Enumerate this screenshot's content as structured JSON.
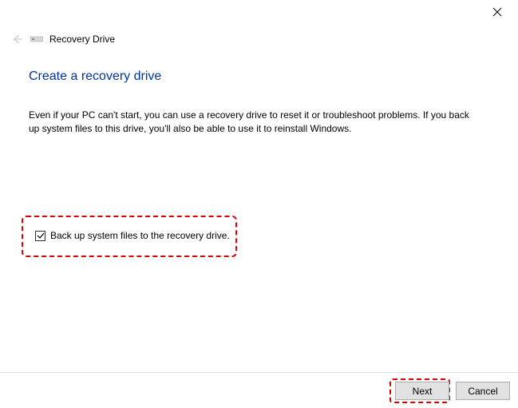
{
  "header": {
    "title": "Recovery Drive"
  },
  "page": {
    "heading": "Create a recovery drive",
    "description": "Even if your PC can't start, you can use a recovery drive to reset it or troubleshoot problems. If you back up system files to this drive, you'll also be able to use it to reinstall Windows."
  },
  "option": {
    "backup_label": "Back up system files to the recovery drive.",
    "checked": true
  },
  "buttons": {
    "next": "Next",
    "cancel": "Cancel"
  }
}
